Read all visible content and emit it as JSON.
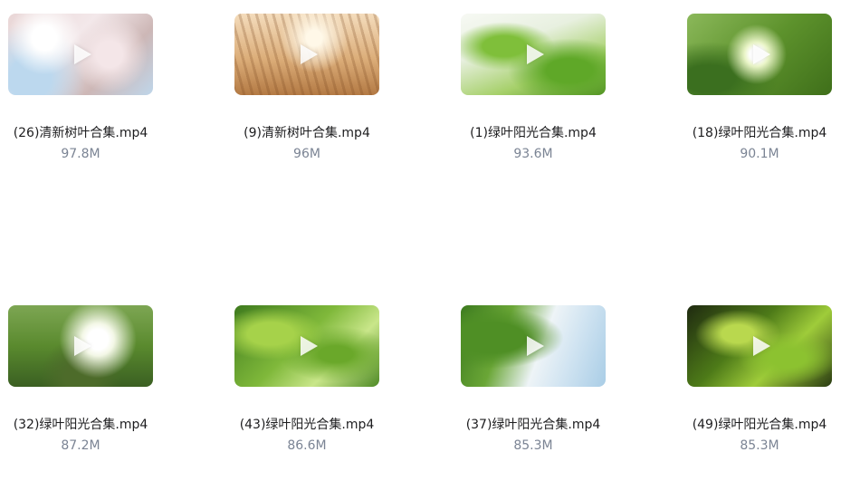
{
  "files": [
    {
      "name": "(26)清新树叶合集.mp4",
      "size": "97.8M",
      "thumb_icon": "play-icon"
    },
    {
      "name": "(9)清新树叶合集.mp4",
      "size": "96M",
      "thumb_icon": "play-icon"
    },
    {
      "name": "(1)绿叶阳光合集.mp4",
      "size": "93.6M",
      "thumb_icon": "play-icon"
    },
    {
      "name": "(18)绿叶阳光合集.mp4",
      "size": "90.1M",
      "thumb_icon": "play-icon"
    },
    {
      "name": "(32)绿叶阳光合集.mp4",
      "size": "87.2M",
      "thumb_icon": "play-icon"
    },
    {
      "name": "(43)绿叶阳光合集.mp4",
      "size": "86.6M",
      "thumb_icon": "play-icon"
    },
    {
      "name": "(37)绿叶阳光合集.mp4",
      "size": "85.3M",
      "thumb_icon": "play-icon"
    },
    {
      "name": "(49)绿叶阳光合集.mp4",
      "size": "85.3M",
      "thumb_icon": "play-icon"
    }
  ],
  "colors": {
    "name_text": "#1d1d1f",
    "size_text": "#7b8494",
    "background": "#ffffff"
  }
}
